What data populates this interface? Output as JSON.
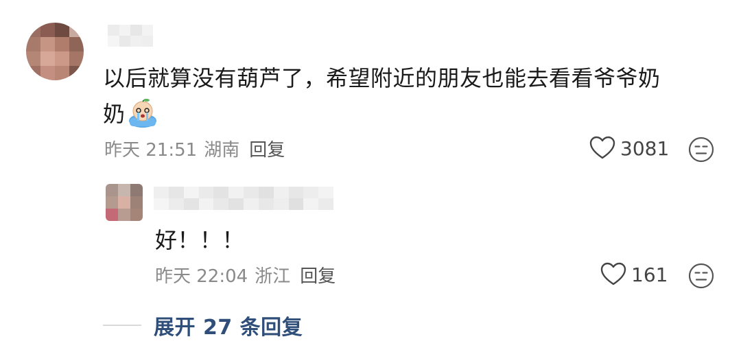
{
  "comments": [
    {
      "text_line1": "以后就算没有葫芦了，希望附近的朋友也能去看看爷爷奶",
      "text_line2": "奶",
      "emoji": "crying-face-emoji",
      "time": "昨天 21:51",
      "location": "湖南",
      "reply_label": "回复",
      "likes": "3081"
    }
  ],
  "reply": {
    "text": "好！！！",
    "time": "昨天 22:04",
    "location": "浙江",
    "reply_label": "回复",
    "likes": "161"
  },
  "expand": {
    "label": "展开 27 条回复"
  },
  "colors": {
    "text": "#1a1a1a",
    "meta": "#8a8a8a",
    "expand": "#2f4f7a"
  },
  "icons": {
    "like": "heart-outline-icon",
    "dislike": "neutral-face-icon"
  }
}
